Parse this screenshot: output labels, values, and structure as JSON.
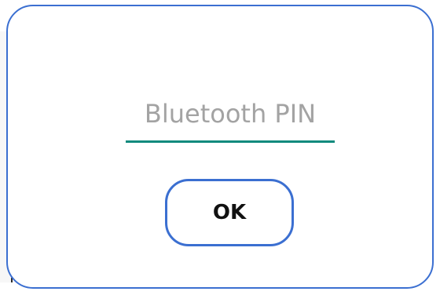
{
  "dialog": {
    "pin_placeholder": "Bluetooth PIN",
    "pin_value": "",
    "ok_label": "OK"
  },
  "colors": {
    "dialog_border": "#3b6fd1",
    "input_underline": "#0f8a7d",
    "placeholder_text": "#a3a3a3"
  }
}
